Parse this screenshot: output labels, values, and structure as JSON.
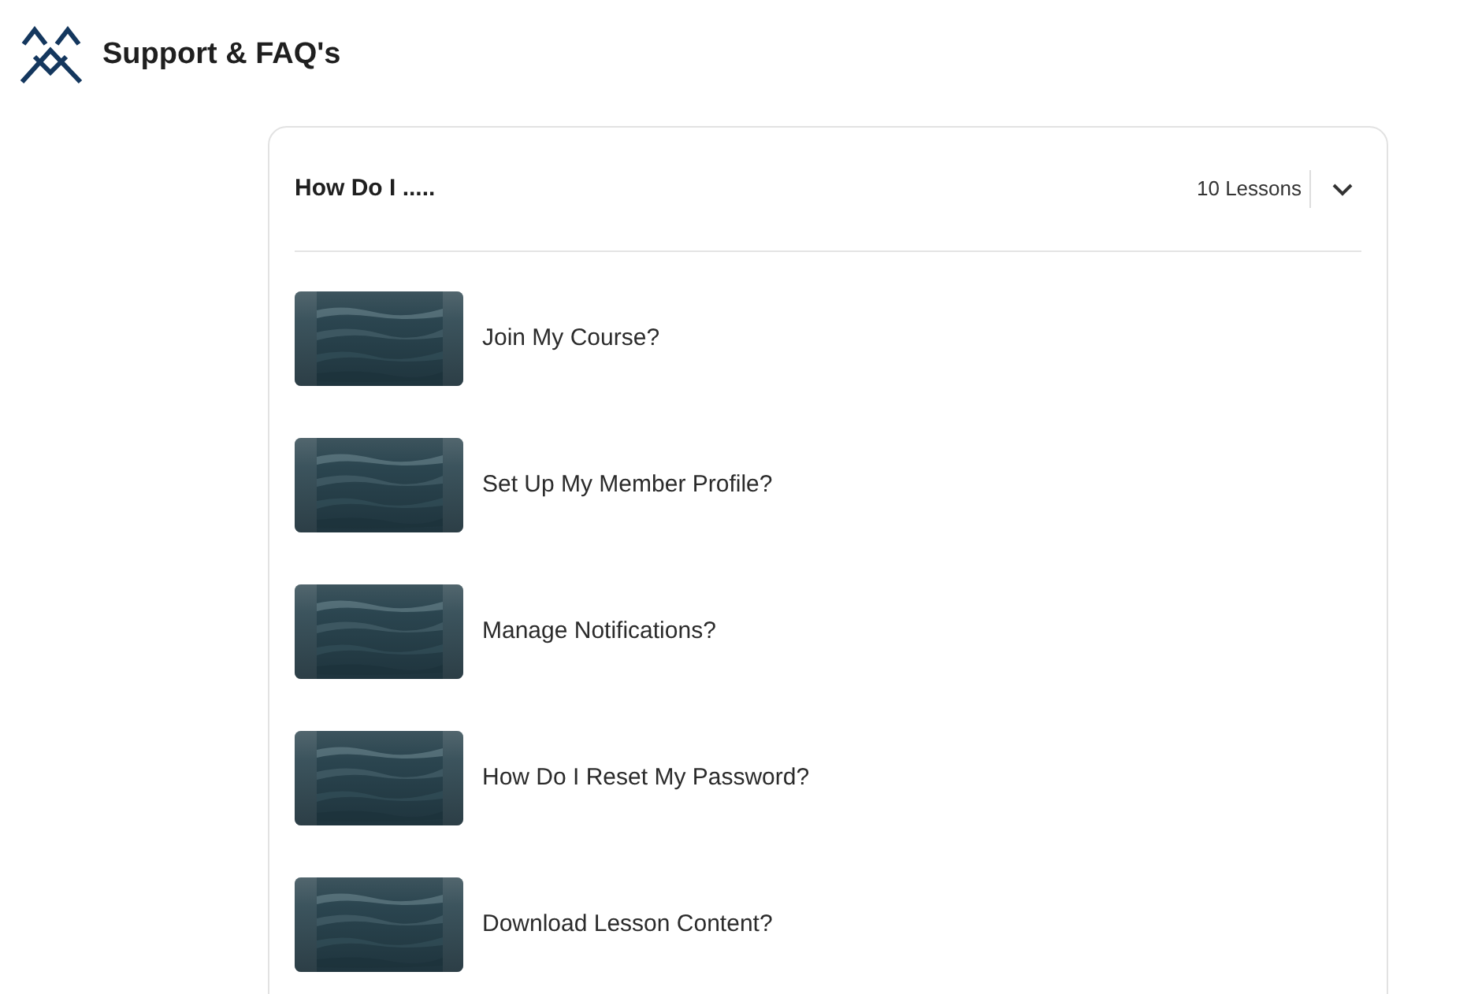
{
  "header": {
    "title": "Support & FAQ's"
  },
  "section": {
    "title": "How Do I .....",
    "count": "10 Lessons",
    "expanded": true,
    "lessons": [
      {
        "title": "Join My Course?",
        "kind": "picture"
      },
      {
        "title": "Set Up My Member Profile?",
        "kind": "picture"
      },
      {
        "title": "Manage Notifications?",
        "kind": "picture"
      },
      {
        "title": "How Do I Reset My Password?",
        "kind": "picture"
      },
      {
        "title": "Download Lesson Content?",
        "kind": "picture"
      }
    ]
  }
}
